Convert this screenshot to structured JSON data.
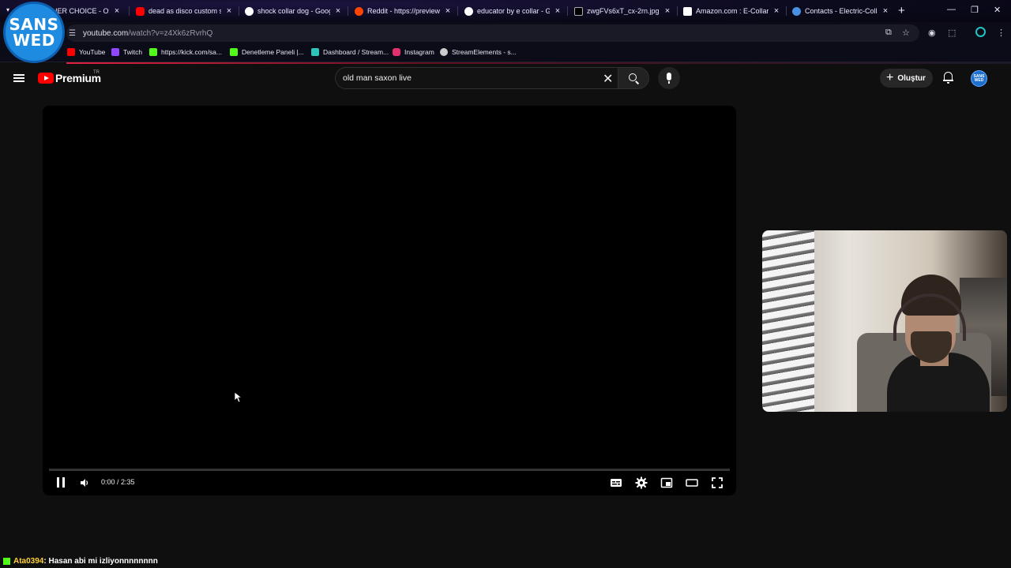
{
  "browser": {
    "tabs": [
      {
        "title": "HER CHOICE - Offi",
        "favicon_color": "#ff0000"
      },
      {
        "title": "dead as disco custom sor",
        "favicon_color": "#ff0000"
      },
      {
        "title": "shock collar dog - Google",
        "favicon_color": "#ffffff"
      },
      {
        "title": "Reddit - https://preview.r",
        "favicon_color": "#ff4500"
      },
      {
        "title": "educator by e collar - Goo",
        "favicon_color": "#ffffff"
      },
      {
        "title": "zwgFVs6xT_cx-2rn.jpg (81",
        "favicon_color": "#000000"
      },
      {
        "title": "Amazon.com : E-Collar - I",
        "favicon_color": "#ffffff"
      },
      {
        "title": "Contacts - Electric-Collar",
        "favicon_color": "#4a90e2"
      }
    ],
    "url_domain": "youtube.com",
    "url_path": "/watch?v=z4Xk6zRvrhQ",
    "bookmarks": [
      {
        "label": "YouTube",
        "color": "#ff0000"
      },
      {
        "label": "Twitch",
        "color": "#9146ff"
      },
      {
        "label": "https://kick.com/sa...",
        "color": "#53fc18"
      },
      {
        "label": "Denetleme Paneli |...",
        "color": "#53fc18"
      },
      {
        "label": "Dashboard / Stream...",
        "color": "#2ec4b6"
      },
      {
        "label": "Instagram",
        "color": "#e1306c"
      },
      {
        "label": "StreamElements - s...",
        "color": "#cccccc"
      }
    ]
  },
  "overlay_logo": {
    "line1": "SANS",
    "line2": "WED"
  },
  "youtube": {
    "brand": "Premium",
    "region": "TR",
    "search_query": "old man saxon live",
    "create_label": "Oluştur",
    "avatar_text": "SANS WED"
  },
  "player": {
    "current_time": "0:00",
    "duration": "2:35",
    "time_display": "0:00 / 2:35",
    "progress_fraction": 0.0
  },
  "chat": {
    "user": "Ata0394",
    "message": ": Hasan abi mi izliyonnnnnnnn"
  }
}
